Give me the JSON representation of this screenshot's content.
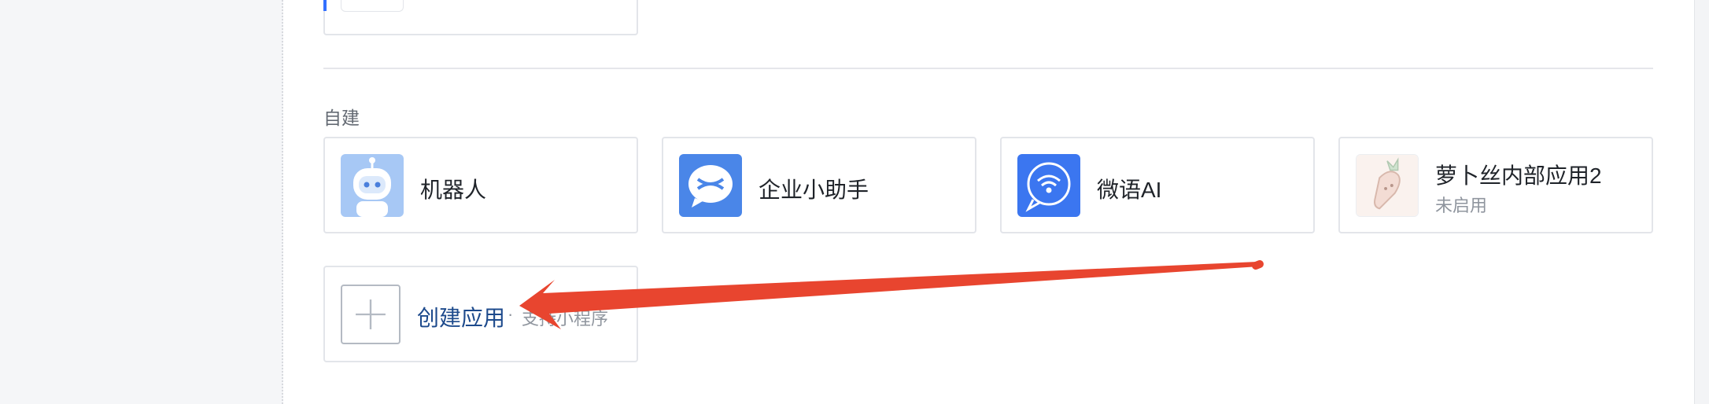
{
  "section": {
    "title": "自建"
  },
  "apps": [
    {
      "name": "机器人",
      "icon": "robot-icon"
    },
    {
      "name": "企业小助手",
      "icon": "assistant-icon"
    },
    {
      "name": "微语AI",
      "icon": "wifi-chat-icon"
    },
    {
      "name": "萝卜丝内部应用2",
      "status": "未启用",
      "icon": "carrot-icon"
    }
  ],
  "create": {
    "label": "创建应用",
    "separator": "·",
    "hint": "支持小程序",
    "icon": "plus-icon"
  },
  "colors": {
    "accent": "#3370ff",
    "create_text": "#1d4a8c",
    "annotation_arrow": "#e8452f"
  }
}
